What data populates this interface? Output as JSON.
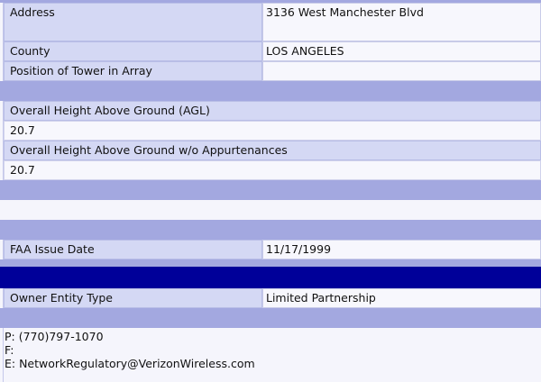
{
  "rows": {
    "address": {
      "label": "Address",
      "value": "3136 West Manchester Blvd"
    },
    "county": {
      "label": "County",
      "value": "LOS ANGELES"
    },
    "position": {
      "label": "Position of Tower in Array",
      "value": ""
    },
    "agl": {
      "label": "Overall Height Above Ground (AGL)",
      "value": "20.7"
    },
    "agl_wo": {
      "label": "Overall Height Above Ground w/o Appurtenances",
      "value": "20.7"
    },
    "faa": {
      "label": "FAA Issue Date",
      "value": "11/17/1999"
    },
    "owner_type": {
      "label": "Owner Entity Type",
      "value": "Limited Partnership"
    }
  },
  "contact": {
    "phone": "P: (770)797-1070",
    "fax": "F:",
    "email": "E: NetworkRegulatory@VerizonWireless.com"
  },
  "colors": {
    "label_bg": "#d4d8f4",
    "value_bg": "#f7f7fd",
    "band": "#a3a8e0",
    "band_dark": "#000099"
  }
}
